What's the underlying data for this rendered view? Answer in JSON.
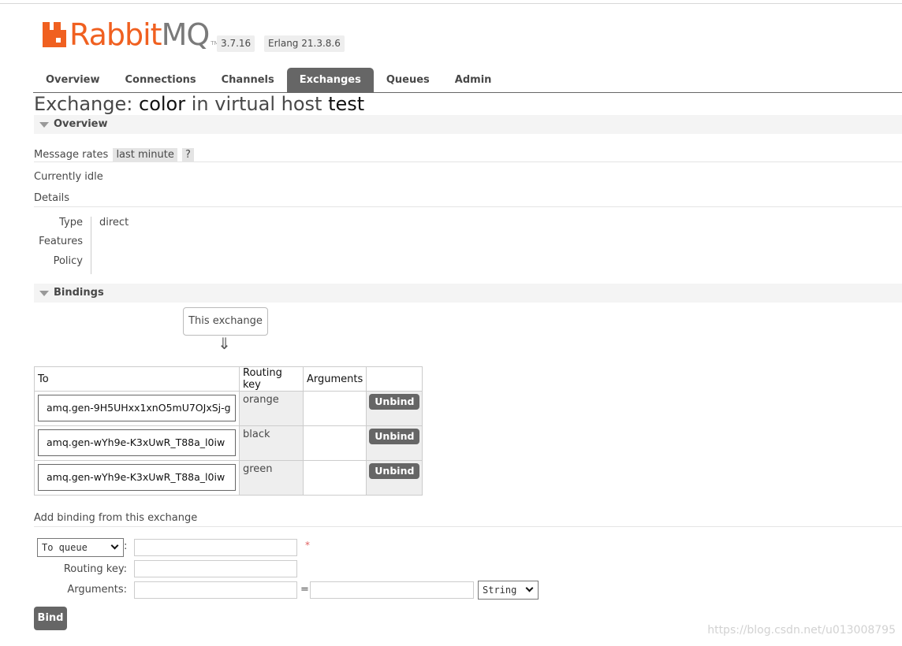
{
  "app": {
    "logo_primary": "Rabbit",
    "logo_secondary": "MQ",
    "logo_tm": "TM",
    "version": "3.7.16",
    "erlang": "Erlang 21.3.8.6"
  },
  "tabs": [
    {
      "label": "Overview",
      "active": false
    },
    {
      "label": "Connections",
      "active": false
    },
    {
      "label": "Channels",
      "active": false
    },
    {
      "label": "Exchanges",
      "active": true
    },
    {
      "label": "Queues",
      "active": false
    },
    {
      "label": "Admin",
      "active": false
    }
  ],
  "title": {
    "prefix": "Exchange:",
    "name": "color",
    "middle": "in virtual host",
    "vhost": "test"
  },
  "overview": {
    "heading": "Overview",
    "message_rates_label": "Message rates",
    "message_rates_range": "last minute",
    "help": "?",
    "status": "Currently idle",
    "details_label": "Details",
    "details": [
      {
        "key": "Type",
        "value": "direct"
      },
      {
        "key": "Features",
        "value": ""
      },
      {
        "key": "Policy",
        "value": ""
      }
    ]
  },
  "bindings": {
    "heading": "Bindings",
    "this_exchange": "This exchange",
    "arrow": "⇓",
    "columns": [
      "To",
      "Routing key",
      "Arguments",
      ""
    ],
    "rows": [
      {
        "to": "amq.gen-9H5UHxx1xnO5mU7OJxSj-g",
        "routing_key": "orange",
        "arguments": "",
        "action": "Unbind"
      },
      {
        "to": "amq.gen-wYh9e-K3xUwR_T88a_l0iw",
        "routing_key": "black",
        "arguments": "",
        "action": "Unbind"
      },
      {
        "to": "amq.gen-wYh9e-K3xUwR_T88a_l0iw",
        "routing_key": "green",
        "arguments": "",
        "action": "Unbind"
      }
    ]
  },
  "add_binding": {
    "heading": "Add binding from this exchange",
    "dest_type": "To queue",
    "colon": ":",
    "required_mark": "*",
    "routing_key_label": "Routing key:",
    "arguments_label": "Arguments:",
    "equals": "=",
    "arg_type": "String",
    "bind_button": "Bind"
  },
  "watermark": "https://blog.csdn.net/u013008795",
  "colors": {
    "accent": "#f06020",
    "tab_active": "#666666",
    "section_bg": "#f4f4f4"
  }
}
